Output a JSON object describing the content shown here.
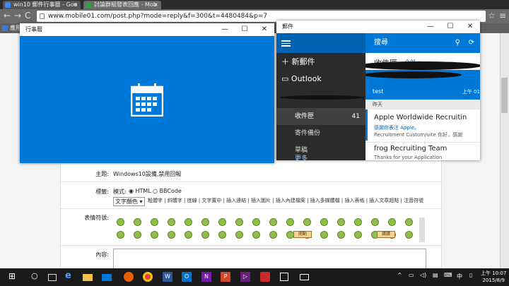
{
  "browser": {
    "tabs": [
      {
        "label": "win10 郵件行事曆 - Goo"
      },
      {
        "label": "討論群組發表回應 - Mob"
      }
    ],
    "address": "www.mobile01.com/post.php?mode=reply&f=300&t=4480484&p=7",
    "bookmark_label": "應用"
  },
  "forum": {
    "subject_label": "主題:",
    "subject_value": "Windows10設備,禁用回報",
    "tags_label": "標籤:",
    "mode_label": "模式:",
    "mode_html": "HTML",
    "mode_bbcode": "BBCode",
    "text_color": "文字顏色",
    "toolbar": "粗體字 | 斜體字 | 底線 | 文字置中 | 插入連結 | 插入圖片 | 插入內建檔案 | 插入多媒體檔 | 插入表格 | 插入文章超點 | 注音符號",
    "emoticon_label": "表情符號:",
    "content_label": "內容:",
    "btn_a": "開動",
    "btn_b": "讚讚"
  },
  "calendar": {
    "title": "行事曆"
  },
  "mail": {
    "title": "郵件",
    "new_mail": "新郵件",
    "account": "Outlook",
    "folders": [
      {
        "label": "收件匣",
        "count": "41"
      },
      {
        "label": "寄件備份",
        "count": ""
      },
      {
        "label": "草稿",
        "count": ""
      }
    ],
    "more": "更多",
    "search": "搜尋",
    "inbox_header": "收件匣",
    "filter": "全部",
    "selected_msg": {
      "subject": "test",
      "time": "上午 01"
    },
    "date_header": "昨天",
    "messages": [
      {
        "sender": "Apple Worldwide Recruitin",
        "subject": "感謝你表注 Apple。",
        "preview": "Recruitment Custom/uite 你好，感謝"
      },
      {
        "sender": "frog Recruiting Team",
        "subject": "Thanks for your Application",
        "preview": ""
      }
    ]
  },
  "taskbar": {
    "time": "上午 10:07",
    "date": "2015/8/9",
    "ime": "中"
  },
  "colors": {
    "calendar_blue": "#0078d7",
    "mail_dark": "#2b2b2b"
  }
}
